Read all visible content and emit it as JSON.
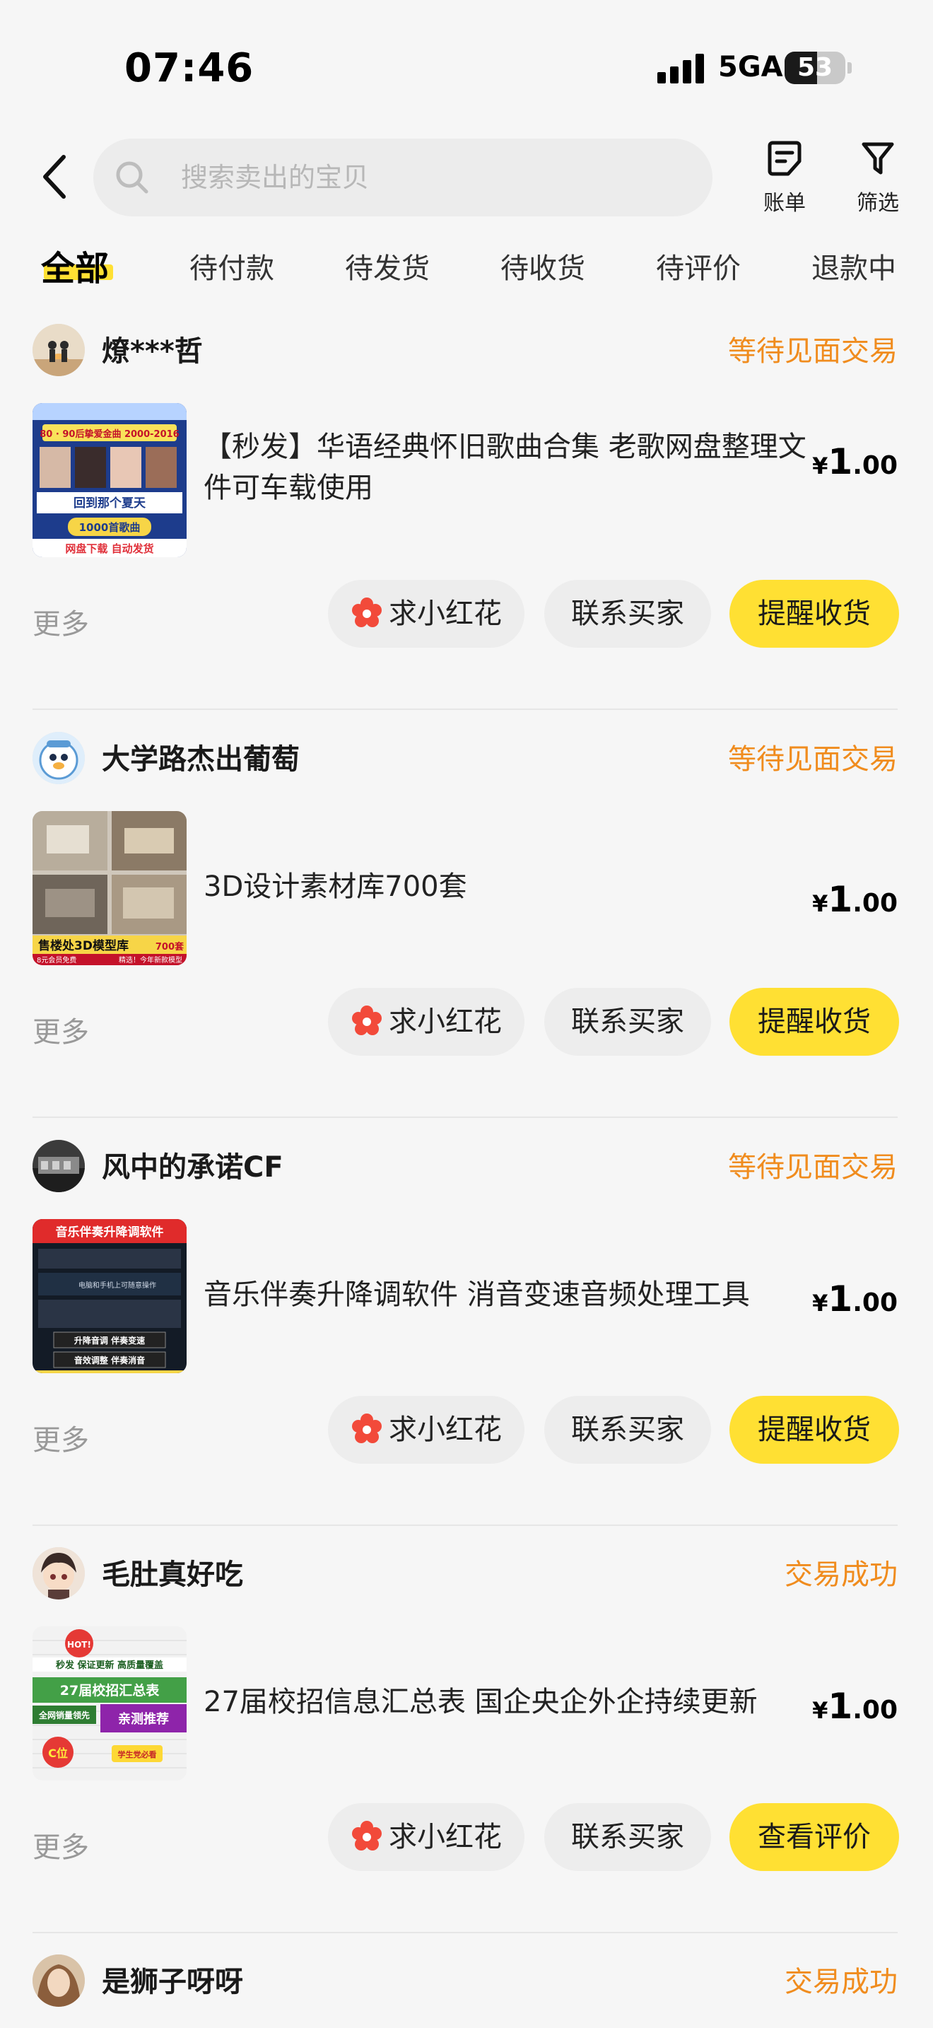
{
  "status_bar": {
    "time": "07:46",
    "network": "5GA",
    "battery_level": "53",
    "battery_fraction": 0.53
  },
  "nav": {
    "search_placeholder": "搜索卖出的宝贝",
    "bill_label": "账单",
    "filter_label": "筛选"
  },
  "tabs": [
    {
      "label": "全部",
      "active": true
    },
    {
      "label": "待付款"
    },
    {
      "label": "待发货"
    },
    {
      "label": "待收货"
    },
    {
      "label": "待评价"
    },
    {
      "label": "退款中"
    }
  ],
  "orders": [
    {
      "seller": "燎***哲",
      "status": "等待见面交易",
      "title": "【秒发】华语经典怀旧歌曲合集 老歌网盘整理文件可车载使用",
      "price_symbol": "¥",
      "price_int": "1",
      "price_dec": ".00",
      "thumb_texts": [
        "80 · 90后挚爱金曲 2000-2016",
        "回到那个夏天",
        "1000首歌曲",
        "网盘下载 自动发货"
      ],
      "more": "更多",
      "btn_flower": "求小红花",
      "btn_contact": "联系买家",
      "btn_primary": "提醒收货"
    },
    {
      "seller": "大学路杰出葡萄",
      "status": "等待见面交易",
      "title": "3D设计素材库700套",
      "price_symbol": "¥",
      "price_int": "1",
      "price_dec": ".00",
      "thumb_texts": [
        "售楼处3D模型库",
        "700套",
        "8元会员免费",
        "精选！今年新款模型"
      ],
      "more": "更多",
      "btn_flower": "求小红花",
      "btn_contact": "联系买家",
      "btn_primary": "提醒收货"
    },
    {
      "seller": "风中的承诺CF",
      "status": "等待见面交易",
      "title": "音乐伴奏升降调软件 消音变速音频处理工具",
      "price_symbol": "¥",
      "price_int": "1",
      "price_dec": ".00",
      "thumb_texts": [
        "音乐伴奏升降调软件",
        "电脑和手机上可随意操作",
        "升降音调 伴奏变速",
        "音效调整 伴奏消音"
      ],
      "more": "更多",
      "btn_flower": "求小红花",
      "btn_contact": "联系买家",
      "btn_primary": "提醒收货"
    },
    {
      "seller": "毛肚真好吃",
      "status": "交易成功",
      "title": "27届校招信息汇总表 国企央企外企持续更新",
      "price_symbol": "¥",
      "price_int": "1",
      "price_dec": ".00",
      "thumb_texts": [
        "HOT!",
        "秒发 保证更新 高质量覆盖",
        "27届校招汇总表",
        "全网销量领先",
        "亲测推荐",
        "C位",
        "学生党必看"
      ],
      "more": "更多",
      "btn_flower": "求小红花",
      "btn_contact": "联系买家",
      "btn_primary": "查看评价"
    },
    {
      "seller": "是狮子呀呀",
      "status": "交易成功"
    }
  ],
  "colors": {
    "accent_yellow": "#ffe033",
    "status_orange": "#f08c1e",
    "flower_red": "#f24a3a",
    "muted_gray": "#999999"
  },
  "icons": [
    "back-arrow-icon",
    "search-icon",
    "bill-icon",
    "filter-icon",
    "flower-icon"
  ]
}
